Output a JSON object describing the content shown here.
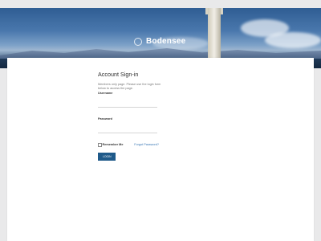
{
  "header": {
    "site_title": "Bodensee",
    "logo_icon": "circle-logo-icon"
  },
  "signin": {
    "title": "Account Sign-in",
    "description": "Members only page. Please use the login form below to access the page.",
    "username_label": "Username",
    "username_value": "",
    "password_label": "Password",
    "password_value": "",
    "remember_label": "Remember Me",
    "forgot_label": "Forgot Password?",
    "login_button": "LOGIN"
  }
}
